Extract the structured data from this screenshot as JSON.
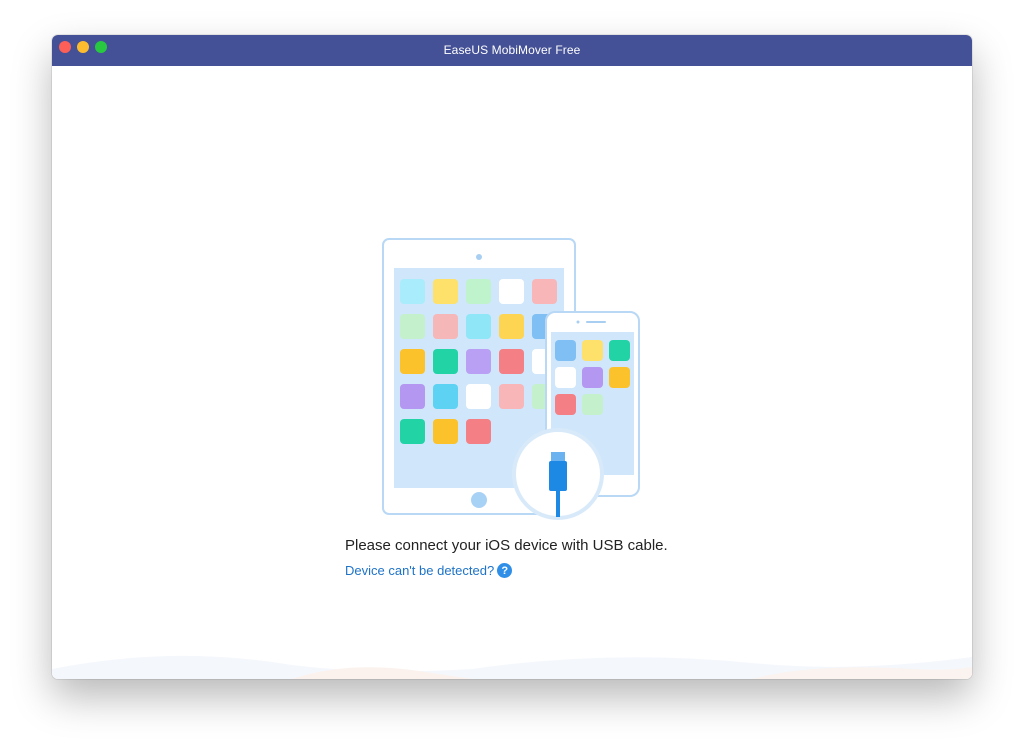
{
  "window": {
    "title": "EaseUS MobiMover Free"
  },
  "main": {
    "message": "Please connect your iOS device with USB cable.",
    "help_link": "Device can't be detected?",
    "help_icon": "question-circle-icon"
  },
  "colors": {
    "titlebar": "#445196",
    "link": "#1e73c8",
    "help_icon": "#2f8fe8",
    "device_outline": "#b8d8f5",
    "screen_bg": "#cfe6fb",
    "usb_connector": "#1e88e5"
  },
  "illustration": {
    "icons": [
      "ipad-icon",
      "iphone-icon",
      "usb-cable-icon"
    ]
  }
}
